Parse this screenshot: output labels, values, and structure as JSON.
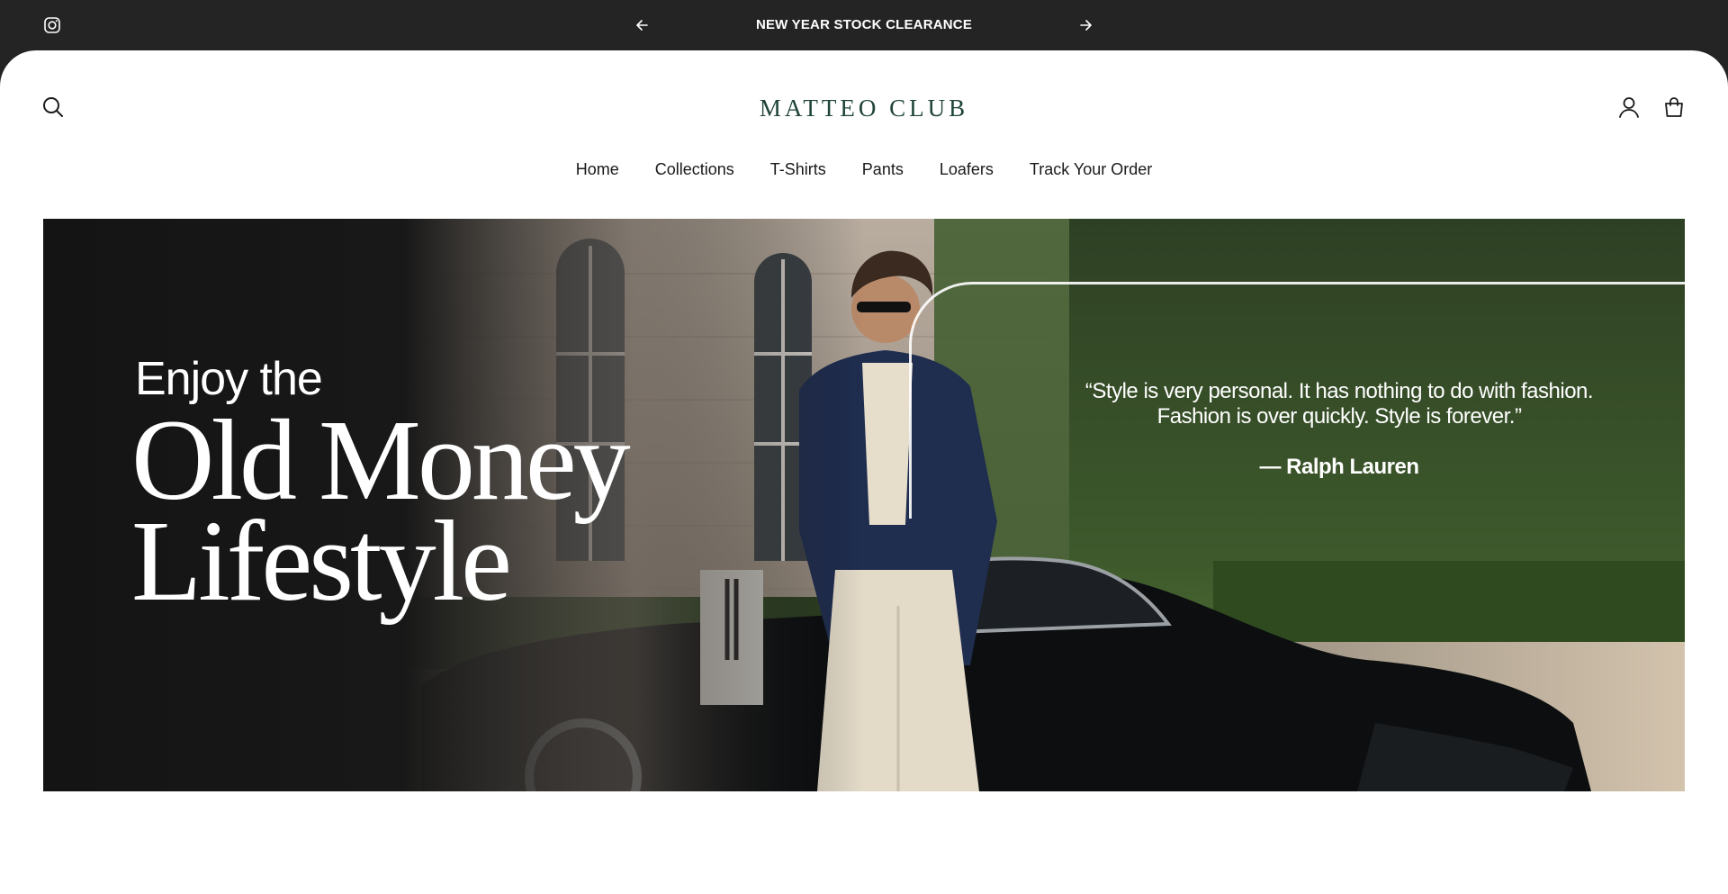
{
  "announcement": {
    "message": "NEW YEAR STOCK CLEARANCE",
    "icons": {
      "social": "instagram-icon",
      "prev": "arrow-left-icon",
      "next": "arrow-right-icon"
    }
  },
  "header": {
    "logo": "MATTEO CLUB",
    "icons": {
      "search": "search-icon",
      "account": "user-icon",
      "cart": "bag-icon"
    }
  },
  "nav": {
    "items": [
      "Home",
      "Collections",
      "T-Shirts",
      "Pants",
      "Loafers",
      "Track Your Order"
    ]
  },
  "hero": {
    "intro": "Enjoy the",
    "headline_1": "Old Money",
    "headline_2": "Lifestyle",
    "quote_line_1": "“Style is very personal. It has nothing to do with fashion.",
    "quote_line_2": "Fashion is over quickly. Style is forever.”",
    "quote_author": "— Ralph Lauren"
  },
  "colors": {
    "topbar": "#242424",
    "logo": "#1f4438",
    "text": "#1a1a1a",
    "background": "#ffffff"
  }
}
